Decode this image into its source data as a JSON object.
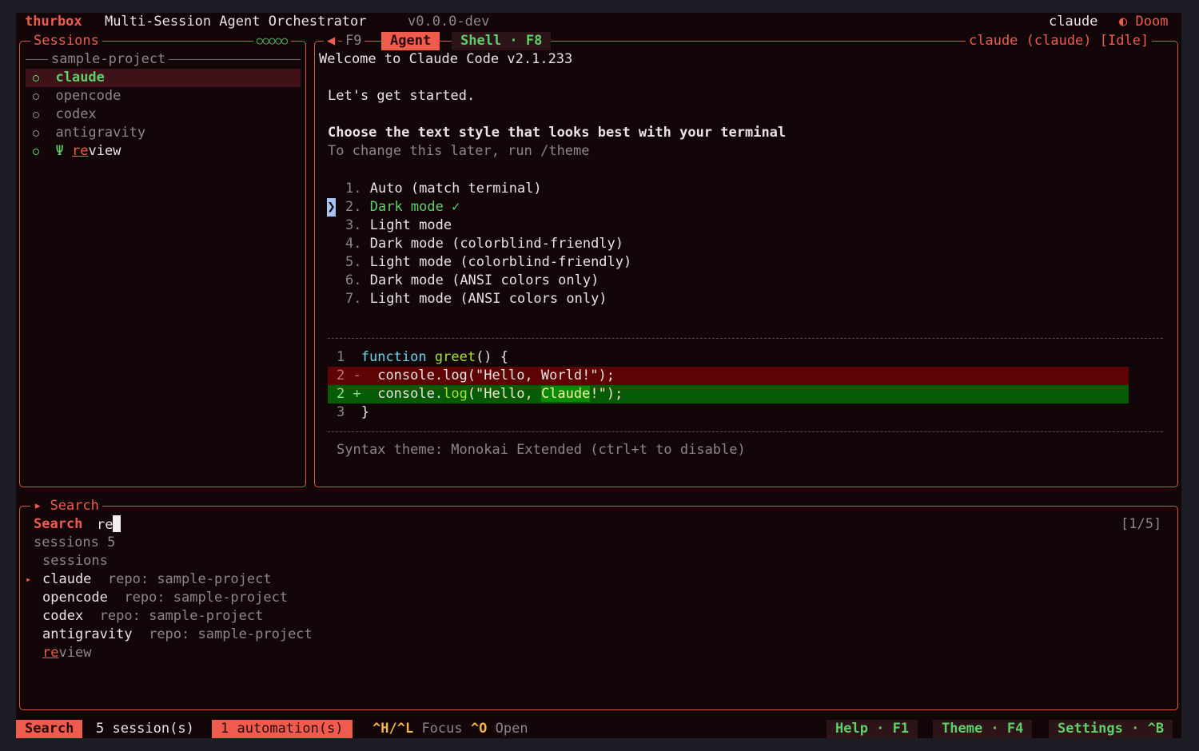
{
  "app": {
    "name": "thurbox",
    "subtitle": "Multi-Session Agent Orchestrator",
    "version": "v0.0.0-dev",
    "user": "claude",
    "theme": "Doom",
    "theme_icon": "◐"
  },
  "sessions_panel": {
    "title": "Sessions",
    "indicator": "○○○○○",
    "group": "sample-project",
    "items": [
      {
        "name": "claude",
        "status": "active",
        "selected": true
      },
      {
        "name": "opencode",
        "status": "idle"
      },
      {
        "name": "codex",
        "status": "idle"
      },
      {
        "name": "antigravity",
        "status": "idle"
      },
      {
        "name_match": "re",
        "name_rest": "view",
        "status": "active",
        "branch_icon": "Ψ"
      }
    ]
  },
  "agent_panel": {
    "prev_key": "F9",
    "prev_arrow": "◀",
    "tab_agent": "Agent",
    "tab_shell": "Shell · F8",
    "status_title": "claude (claude) [Idle]",
    "welcome": "Welcome to Claude Code v2.1.233",
    "intro": "Let's get started.",
    "heading": "Choose the text style that looks best with your terminal",
    "hint": "To change this later, run /theme",
    "cursor": "❯",
    "options": [
      {
        "num": "1.",
        "label": "Auto (match terminal)"
      },
      {
        "num": "2.",
        "label": "Dark mode ✓",
        "selected": true
      },
      {
        "num": "3.",
        "label": "Light mode"
      },
      {
        "num": "4.",
        "label": "Dark mode (colorblind-friendly)"
      },
      {
        "num": "5.",
        "label": "Light mode (colorblind-friendly)"
      },
      {
        "num": "6.",
        "label": "Dark mode (ANSI colors only)"
      },
      {
        "num": "7.",
        "label": "Light mode (ANSI colors only)"
      }
    ],
    "code": {
      "l1_num": "1",
      "l1_kw": "function",
      "l1_fn": "greet",
      "l1_rest": "() {",
      "l2_num": "2 -",
      "l2_text": "console.log(\"Hello, World!\");",
      "l3_num": "2 +",
      "l3_pre": "console.",
      "l3_fn": "log",
      "l3_str1": "(\"Hello, ",
      "l3_hl": "Claude",
      "l3_str2": "!\"",
      "l3_end": ");",
      "l4_num": "3",
      "l4_text": "}"
    },
    "syntax_note": "Syntax theme: Monokai Extended (ctrl+t to disable)"
  },
  "search_panel": {
    "title": "Search",
    "title_arrow": "▸",
    "label": "Search",
    "query": "re",
    "counter": "[1/5]",
    "summary": "sessions 5",
    "section": "sessions",
    "results": [
      {
        "name": "claude",
        "repo": "repo: sample-project",
        "selected": true
      },
      {
        "name": "opencode",
        "repo": "repo: sample-project"
      },
      {
        "name": "codex",
        "repo": "repo: sample-project"
      },
      {
        "name": "antigravity",
        "repo": "repo: sample-project"
      },
      {
        "name_match": "re",
        "name_rest": "view"
      }
    ]
  },
  "status_bar": {
    "mode": "Search",
    "sessions": "5 session(s)",
    "automations": "1 automation(s)",
    "focus_keys": "^H/^L",
    "focus_label": "Focus",
    "open_key": "^O",
    "open_label": "Open",
    "help": "Help · F1",
    "theme": "Theme · F4",
    "settings": "Settings · ^B"
  },
  "colors": {
    "background": "#120609",
    "accent": "#ef5b4d",
    "green": "#5fd068",
    "diff_removed": "#5e0404",
    "diff_added": "#055c04"
  }
}
